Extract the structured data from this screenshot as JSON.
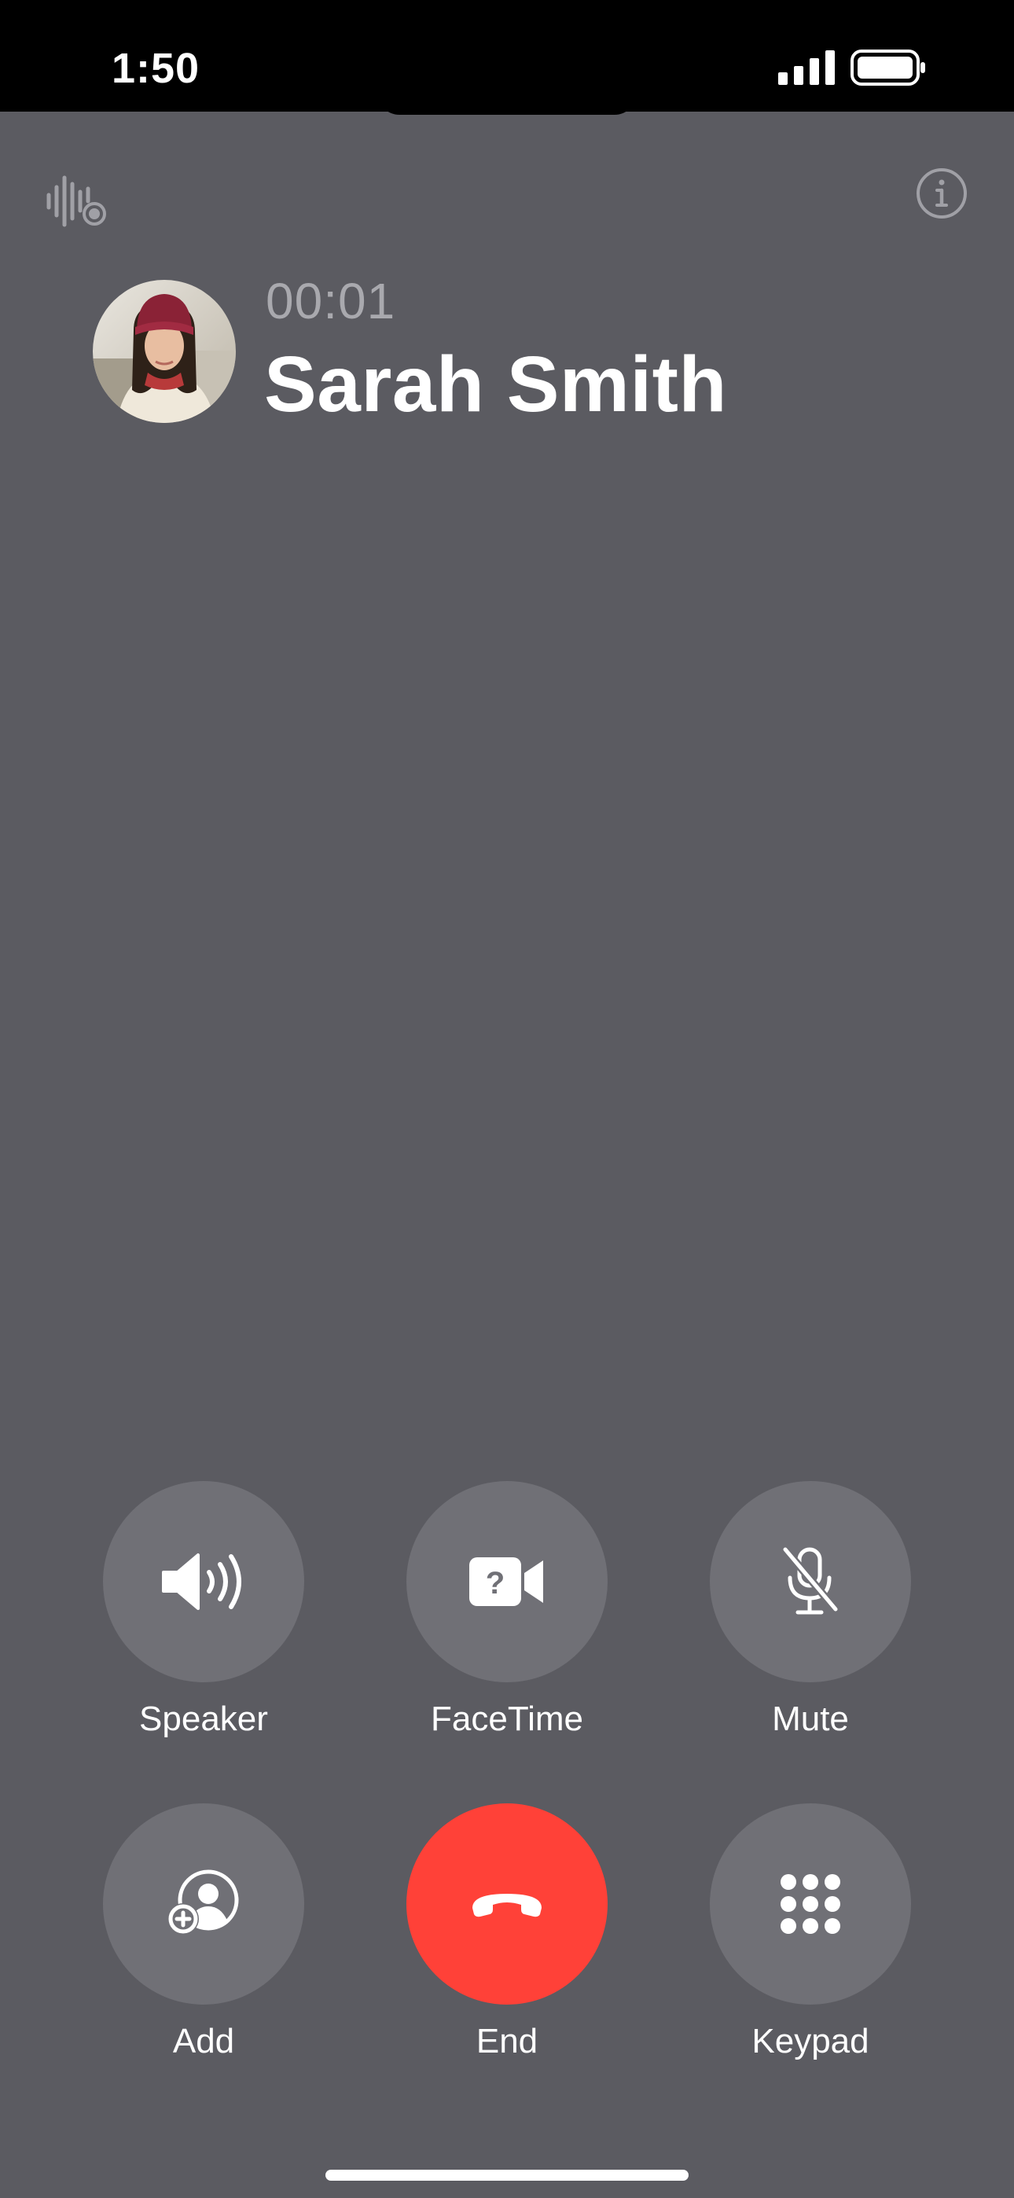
{
  "status_bar": {
    "time": "1:50"
  },
  "call": {
    "timer": "00:01",
    "caller_name": "Sarah Smith"
  },
  "controls": {
    "speaker": "Speaker",
    "facetime": "FaceTime",
    "mute": "Mute",
    "add": "Add",
    "end": "End",
    "keypad": "Keypad"
  },
  "icons": {
    "audio": "audio-waveform-record-icon",
    "info": "info-icon",
    "speaker": "speaker-wave-icon",
    "facetime": "video-question-icon",
    "mute": "microphone-slash-icon",
    "add": "person-add-icon",
    "end": "phone-down-icon",
    "keypad": "keypad-grid-icon"
  },
  "colors": {
    "background": "#5b5b61",
    "button": "#707076",
    "end_button": "#ff4138",
    "timer_text": "#a9a9ae"
  }
}
